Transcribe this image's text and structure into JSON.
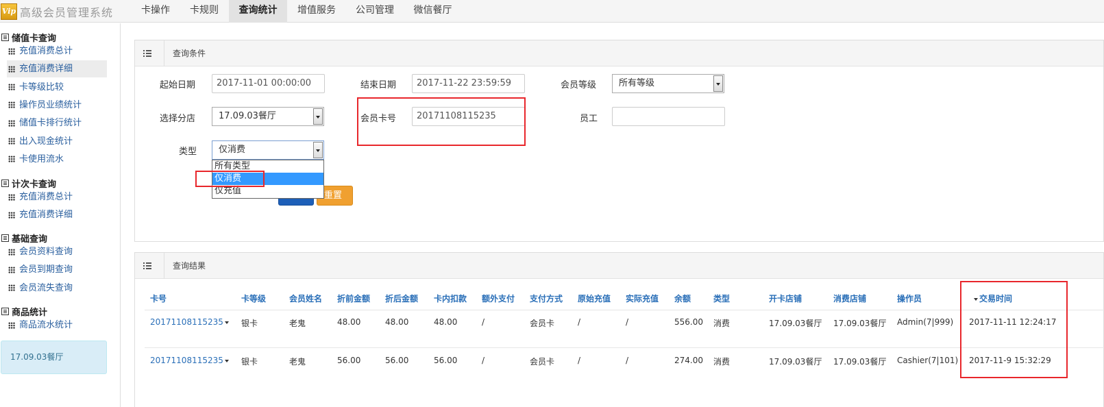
{
  "app": {
    "logo_badge": "Vip",
    "logo_text": "高级会员管理系统"
  },
  "nav": [
    "卡操作",
    "卡规则",
    "查询统计",
    "增值服务",
    "公司管理",
    "微信餐厅"
  ],
  "nav_active": 2,
  "sidebar": {
    "sections": [
      {
        "title": "储值卡查询",
        "items": [
          "充值消费总计",
          "充值消费详细",
          "卡等级比较",
          "操作员业绩统计",
          "储值卡排行统计",
          "出入现金统计",
          "卡使用流水"
        ]
      },
      {
        "title": "计次卡查询",
        "items": [
          "充值消费总计",
          "充值消费详细"
        ]
      },
      {
        "title": "基础查询",
        "items": [
          "会员资料查询",
          "会员到期查询",
          "会员流失查询"
        ]
      },
      {
        "title": "商品统计",
        "items": [
          "商品流水统计"
        ]
      }
    ],
    "active_item": "充值消费详细",
    "branch": "17.09.03餐厅"
  },
  "query": {
    "title": "查询条件",
    "start_label": "起始日期",
    "start_value": "2017-11-01 00:00:00",
    "end_label": "结束日期",
    "end_value": "2017-11-22 23:59:59",
    "level_label": "会员等级",
    "level_value": "所有等级",
    "branch_label": "选择分店",
    "branch_value": "17.09.03餐厅",
    "card_label": "会员卡号",
    "card_value": "20171108115235",
    "staff_label": "员工",
    "staff_value": "",
    "type_label": "类型",
    "type_value": "仅消费",
    "type_options": [
      "所有类型",
      "仅消费",
      "仅充值"
    ],
    "reset_label": "重置"
  },
  "results": {
    "title": "查询结果",
    "columns": [
      "卡号",
      "卡等级",
      "会员姓名",
      "折前金额",
      "折后金额",
      "卡内扣款",
      "额外支付",
      "支付方式",
      "原始充值",
      "实际充值",
      "余额",
      "类型",
      "开卡店铺",
      "消费店铺",
      "操作员",
      "交易时间"
    ],
    "rows": [
      [
        "20171108115235",
        "银卡",
        "老鬼",
        "48.00",
        "48.00",
        "48.00",
        "/",
        "会员卡",
        "/",
        "/",
        "556.00",
        "消费",
        "17.09.03餐厅",
        "17.09.03餐厅",
        "Admin(7|999)",
        "2017-11-11 12:24:17"
      ],
      [
        "20171108115235",
        "银卡",
        "老鬼",
        "56.00",
        "56.00",
        "56.00",
        "/",
        "会员卡",
        "/",
        "/",
        "274.00",
        "消费",
        "17.09.03餐厅",
        "17.09.03餐厅",
        "Cashier(7|101)",
        "2017-11-9 15:32:29"
      ]
    ]
  },
  "colors": {
    "link": "#2a6fb8",
    "highlight": "#e8262b",
    "select_blue": "#3399ff",
    "reset_orange": "#f0a030"
  }
}
